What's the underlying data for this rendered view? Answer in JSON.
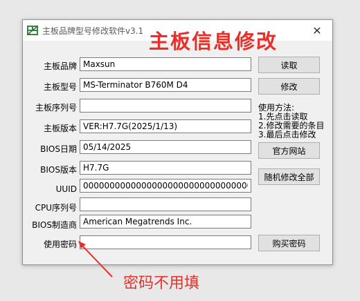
{
  "window": {
    "title": "主板品牌型号修改软件v3.1",
    "close_label": "✕"
  },
  "overlay_title": "主板信息修改",
  "fields": [
    {
      "label": "主板品牌",
      "value": "Maxsun"
    },
    {
      "label": "主板型号",
      "value": "MS-Terminator B760M D4"
    },
    {
      "label": "主板序列号",
      "value": ""
    },
    {
      "label": "主板版本",
      "value": "VER:H7.7G(2025/1/13)"
    },
    {
      "label": "BIOS日期",
      "value": "05/14/2025"
    },
    {
      "label": "BIOS版本",
      "value": "H7.7G"
    },
    {
      "label": "UUID",
      "value": "00000000000000000000000000000000"
    },
    {
      "label": "CPU序列号",
      "value": ""
    },
    {
      "label": "BIOS制造商",
      "value": "American Megatrends Inc."
    },
    {
      "label": "使用密码",
      "value": ""
    }
  ],
  "buttons": {
    "read": "读取",
    "modify": "修改",
    "official_site": "官方网站",
    "random_modify_all": "随机修改全部",
    "buy_password": "购买密码"
  },
  "usage": {
    "title": "使用方法:",
    "steps": [
      "1.先点击读取",
      "2.修改需要的条目",
      "3.最后点击修改"
    ]
  },
  "annotation": "密码不用填",
  "colors": {
    "annotation_red": "#e8302a",
    "window_bg": "#f0f0f0",
    "button_bg": "#e1e1e1"
  },
  "icons": {
    "app": "app-window-icon",
    "close": "close-icon"
  }
}
